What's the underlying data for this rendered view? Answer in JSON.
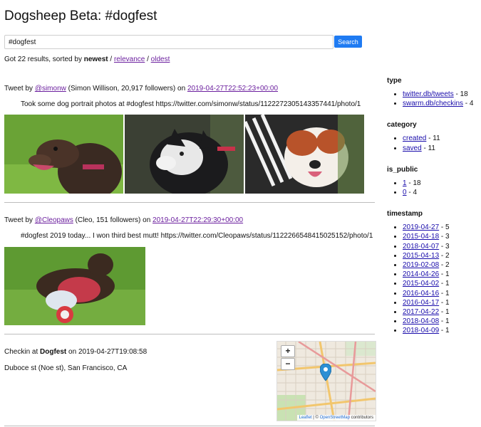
{
  "page": {
    "title": "Dogsheep Beta: #dogfest"
  },
  "search": {
    "value": "#dogfest",
    "button_label": "Search"
  },
  "summary": {
    "prefix": "Got 22 results, sorted by ",
    "current_sort": "newest",
    "sep1": " / ",
    "relevance_label": "relevance",
    "sep2": " / ",
    "oldest_label": "oldest"
  },
  "results": [
    {
      "prefix": "Tweet by ",
      "user": "@simonw",
      "user_details": " (Simon Willison, 20,917 followers) on ",
      "timestamp": "2019-04-27T22:52:23+00:00",
      "text": "Took some dog portrait photos at #dogfest https://twitter.com/simonw/status/1122272305143357441/photo/1"
    },
    {
      "prefix": "Tweet by ",
      "user": "@Cleopaws",
      "user_details": " (Cleo, 151 followers) on ",
      "timestamp": "2019-04-27T22:29:30+00:00",
      "text": "#dogfest 2019 today... I won third best mutt! https://twitter.com/Cleopaws/status/1122266548415025152/photo/1"
    },
    {
      "prefix": "Checkin at ",
      "venue": "Dogfest",
      "on_text": " on 2019-04-27T19:08:58",
      "address": "Duboce st (Noe st), San Francisco, CA"
    }
  ],
  "map": {
    "zoom_in": "+",
    "zoom_out": "−",
    "attribution_leaflet": "Leaflet",
    "attribution_sep": " | © ",
    "attribution_osm": "OpenStreetMap",
    "attribution_suffix": " contributors"
  },
  "facets": [
    {
      "title": "type",
      "items": [
        {
          "label": "twitter.db/tweets",
          "count": " - 18"
        },
        {
          "label": "swarm.db/checkins",
          "count": " - 4"
        }
      ]
    },
    {
      "title": "category",
      "items": [
        {
          "label": "created",
          "count": " - 11"
        },
        {
          "label": "saved",
          "count": " - 11"
        }
      ]
    },
    {
      "title": "is_public",
      "items": [
        {
          "label": "1",
          "count": " - 18"
        },
        {
          "label": "0",
          "count": " - 4"
        }
      ]
    },
    {
      "title": "timestamp",
      "items": [
        {
          "label": "2019-04-27",
          "count": " - 5"
        },
        {
          "label": "2015-04-18",
          "count": " - 3"
        },
        {
          "label": "2018-04-07",
          "count": " - 3"
        },
        {
          "label": "2015-04-13",
          "count": " - 2"
        },
        {
          "label": "2019-02-08",
          "count": " - 2"
        },
        {
          "label": "2014-04-26",
          "count": " - 1"
        },
        {
          "label": "2015-04-02",
          "count": " - 1"
        },
        {
          "label": "2016-04-16",
          "count": " - 1"
        },
        {
          "label": "2016-04-17",
          "count": " - 1"
        },
        {
          "label": "2017-04-22",
          "count": " - 1"
        },
        {
          "label": "2018-04-08",
          "count": " - 1"
        },
        {
          "label": "2018-04-09",
          "count": " - 1"
        }
      ]
    }
  ],
  "colors": {
    "accent": "#1f7bf2",
    "link": "#1a0dab",
    "visited": "#6b1f9e",
    "divider": "#bdbdbd"
  }
}
